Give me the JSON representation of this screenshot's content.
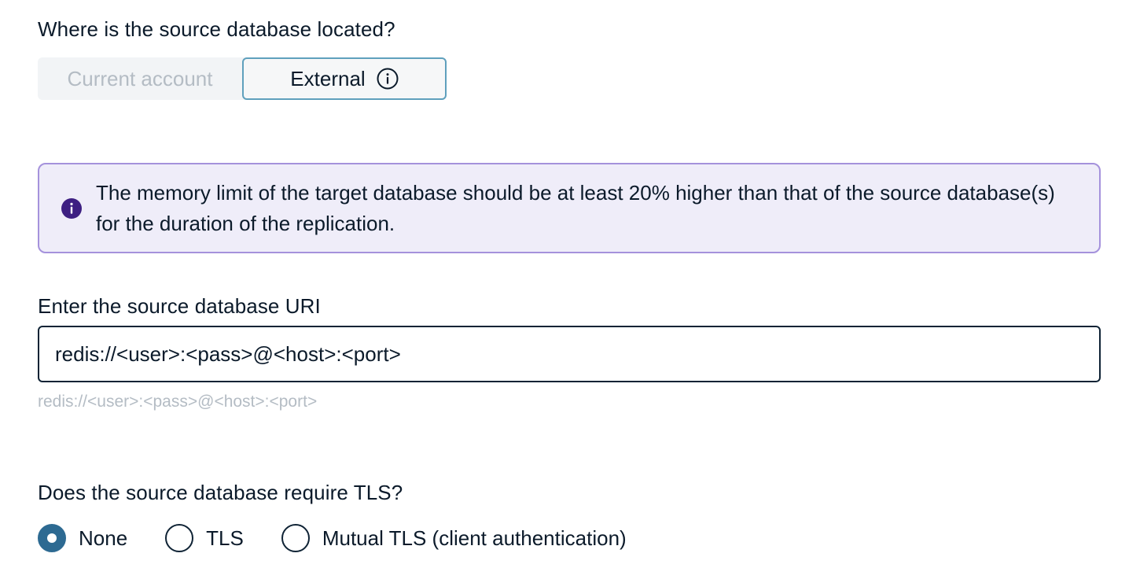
{
  "location": {
    "question": "Where is the source database located?",
    "options": [
      {
        "label": "Current account",
        "selected": false
      },
      {
        "label": "External",
        "selected": true
      }
    ]
  },
  "banner": {
    "icon": "info-icon",
    "text": "The memory limit of the target database should be at least 20% higher than that of the source database(s) for the duration of the replication.",
    "accent_color": "#a592dc",
    "background_color": "#efedf9"
  },
  "uri": {
    "label": "Enter the source database URI",
    "value": "redis://<user>:<pass>@<host>:<port>",
    "hint": "redis://<user>:<pass>@<host>:<port>"
  },
  "tls": {
    "question": "Does the source database require TLS?",
    "options": [
      {
        "label": "None",
        "selected": true
      },
      {
        "label": "TLS",
        "selected": false
      },
      {
        "label": "Mutual TLS (client authentication)",
        "selected": false
      }
    ],
    "selected_color": "#2d6a92"
  }
}
